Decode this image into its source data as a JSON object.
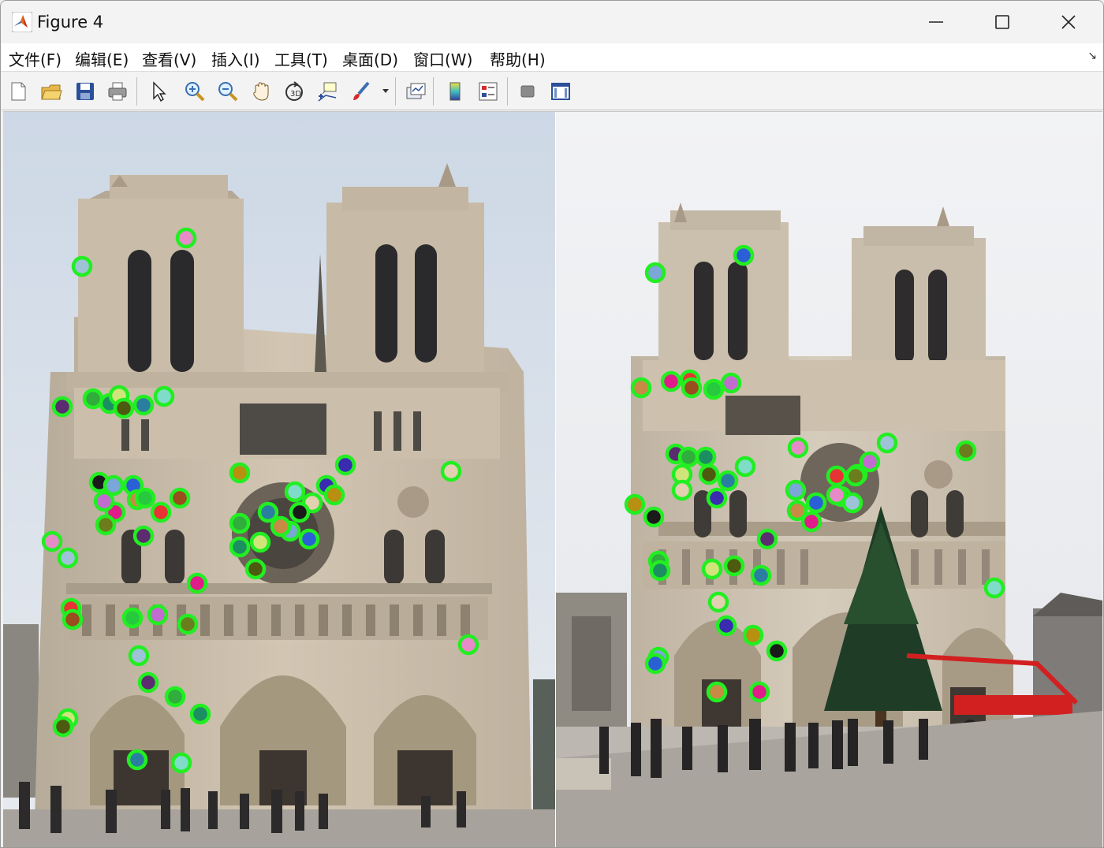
{
  "window": {
    "title": "Figure 4"
  },
  "menu": {
    "items": [
      "文件(F)",
      "编辑(E)",
      "查看(V)",
      "插入(I)",
      "工具(T)",
      "桌面(D)",
      "窗口(W)",
      "帮助(H)"
    ]
  },
  "toolbar": {
    "buttons": [
      "new-figure",
      "open-file",
      "save-figure",
      "print-figure",
      "edit-plot",
      "zoom-in",
      "zoom-out",
      "pan",
      "rotate-3d",
      "data-cursor",
      "brush",
      "link-plot",
      "insert-colorbar",
      "insert-legend",
      "hide-plot-tools",
      "show-plot-tools"
    ]
  },
  "images": {
    "left": {
      "subject": "Notre-Dame de Paris, frontal view"
    },
    "right": {
      "subject": "Notre-Dame de Paris, wide view with Christmas tree"
    }
  },
  "colors": {
    "keypoint_ring": "#22ee22",
    "sky_left": "#e3e8ef",
    "sky_right": "#ebedf0",
    "stone": "#cbbfae"
  }
}
